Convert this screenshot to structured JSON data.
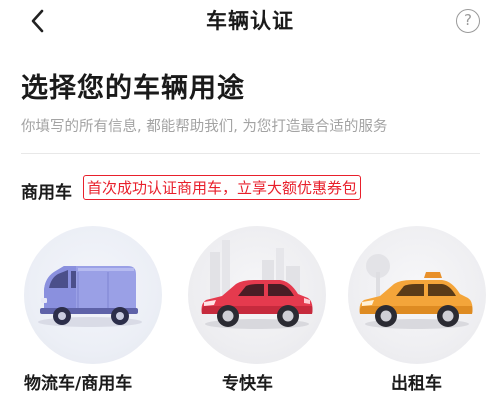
{
  "nav": {
    "title": "车辆认证",
    "help_label": "?"
  },
  "header": {
    "title": "选择您的车辆用途",
    "subtitle": "你填写的所有信息, 都能帮助我们, 为您打造最合适的服务"
  },
  "category": {
    "label": "商用车",
    "promo": "首次成功认证商用车，立享大额优惠券包"
  },
  "vehicles": [
    {
      "label": "物流车/商用车",
      "icon": "van-icon",
      "color": "#8a90e0"
    },
    {
      "label": "专快车",
      "icon": "suv-car-icon",
      "color": "#e0344a"
    },
    {
      "label": "出租车",
      "icon": "taxi-car-icon",
      "color": "#f4a53a"
    }
  ],
  "colors": {
    "accent_red": "#e8202c",
    "subtitle_gray": "#a3a3a3"
  }
}
